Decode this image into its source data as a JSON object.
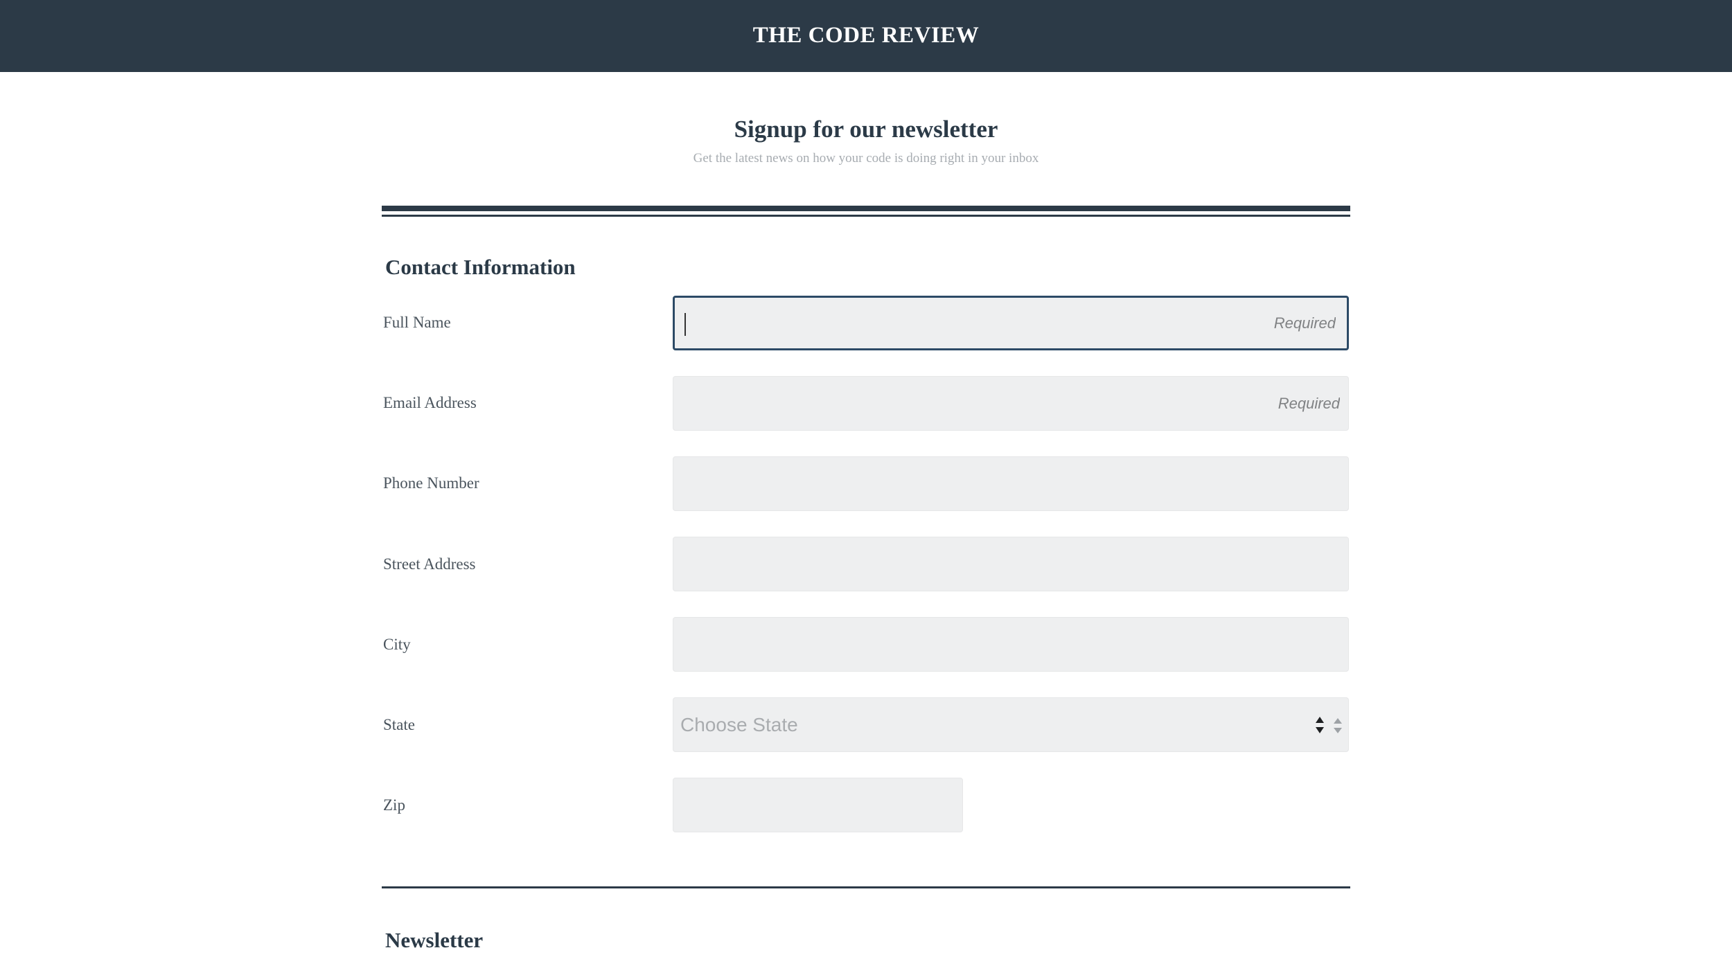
{
  "header": {
    "site_title": "THE CODE REVIEW"
  },
  "intro": {
    "title": "Signup for our newsletter",
    "subtitle": "Get the latest news on how your code is doing right in your inbox"
  },
  "contact_section": {
    "heading": "Contact Information",
    "fields": {
      "full_name": {
        "label": "Full Name",
        "value": "",
        "placeholder": "Required"
      },
      "email": {
        "label": "Email Address",
        "value": "",
        "placeholder": "Required"
      },
      "phone": {
        "label": "Phone Number",
        "value": "",
        "placeholder": ""
      },
      "street": {
        "label": "Street Address",
        "value": "",
        "placeholder": ""
      },
      "city": {
        "label": "City",
        "value": "",
        "placeholder": ""
      },
      "state": {
        "label": "State",
        "selected": "Choose State"
      },
      "zip": {
        "label": "Zip",
        "value": "",
        "placeholder": ""
      }
    }
  },
  "newsletter_section": {
    "heading": "Newsletter"
  },
  "colors": {
    "header_bg": "#2c3a47",
    "input_bg": "#eeeff0",
    "focus_border": "#2c4a66",
    "heading_text": "#2b3a47",
    "subtitle_text": "#a7acb1"
  },
  "icons": {
    "state_select": "select-stepper-icon"
  }
}
